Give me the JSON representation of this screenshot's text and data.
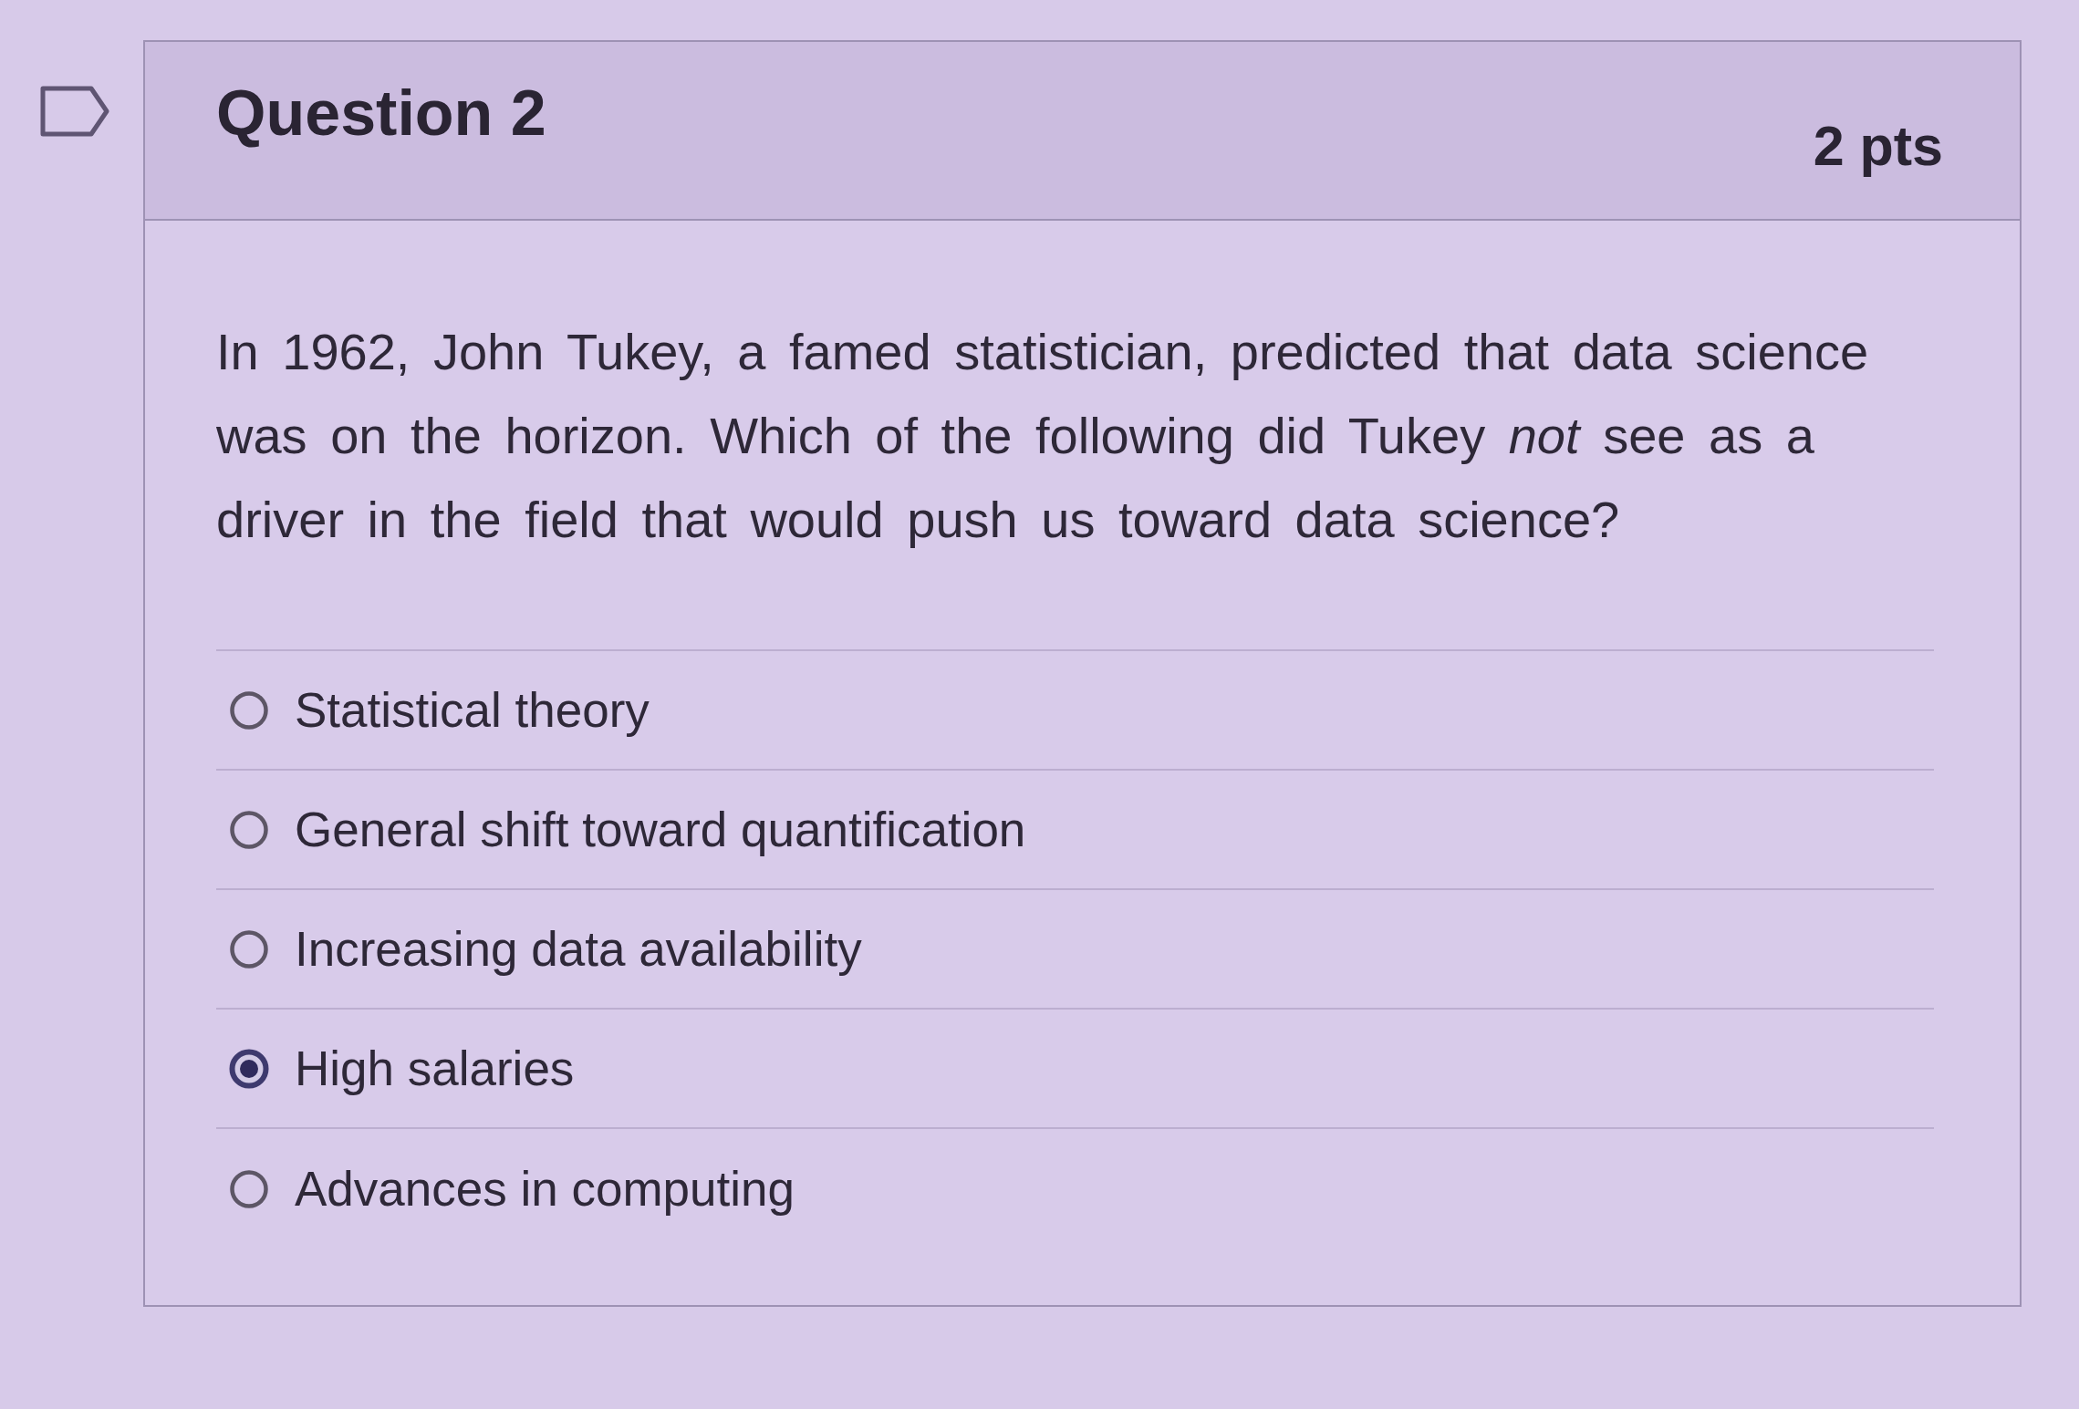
{
  "question": {
    "flagged": false,
    "title": "Question 2",
    "points": "2 pts",
    "text": "In 1962, John Tukey, a famed statistician, predicted that data science was on the horizon. Which of the following did Tukey *not* see as a driver in the field that would push us toward data science?"
  },
  "answers": [
    {
      "label": "Statistical theory",
      "selected": false
    },
    {
      "label": "General shift toward quantification",
      "selected": false
    },
    {
      "label": "Increasing data availability",
      "selected": false
    },
    {
      "label": "High salaries",
      "selected": true
    },
    {
      "label": "Advances in computing",
      "selected": false
    }
  ]
}
